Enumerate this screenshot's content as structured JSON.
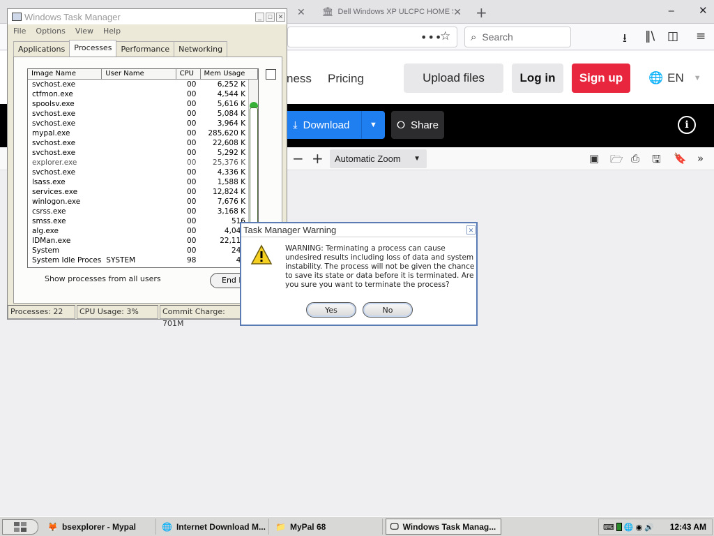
{
  "browser": {
    "tabs": [
      {
        "label": "Dell Windows XP ULCPC HOME S"
      }
    ],
    "toolbar": {
      "search_placeholder": "Search"
    },
    "header": {
      "nav_partial": "ness",
      "pricing": "Pricing",
      "upload": "Upload files",
      "login": "Log in",
      "signup": "Sign up",
      "lang": "EN"
    },
    "actionbar": {
      "download": "Download",
      "share": "Share"
    },
    "pdf": {
      "zoom": "Automatic Zoom"
    }
  },
  "taskmgr": {
    "title": "Windows Task Manager",
    "menu": [
      "File",
      "Options",
      "View",
      "Help"
    ],
    "tabs": [
      "Applications",
      "Processes",
      "Performance",
      "Networking"
    ],
    "columns": {
      "name": "Image Name",
      "user": "User Name",
      "cpu": "CPU",
      "mem": "Mem Usage"
    },
    "processes": [
      {
        "name": "svchost.exe",
        "user": "",
        "cpu": "00",
        "mem": "6,252 K"
      },
      {
        "name": "ctfmon.exe",
        "user": "",
        "cpu": "00",
        "mem": "4,544 K"
      },
      {
        "name": "spoolsv.exe",
        "user": "",
        "cpu": "00",
        "mem": "5,616 K"
      },
      {
        "name": "svchost.exe",
        "user": "",
        "cpu": "00",
        "mem": "5,084 K"
      },
      {
        "name": "svchost.exe",
        "user": "",
        "cpu": "00",
        "mem": "3,964 K"
      },
      {
        "name": "mypal.exe",
        "user": "",
        "cpu": "00",
        "mem": "285,620 K"
      },
      {
        "name": "svchost.exe",
        "user": "",
        "cpu": "00",
        "mem": "22,608 K"
      },
      {
        "name": "svchost.exe",
        "user": "",
        "cpu": "00",
        "mem": "5,292 K"
      },
      {
        "name": "explorer.exe",
        "user": "",
        "cpu": "00",
        "mem": "25,376 K"
      },
      {
        "name": "svchost.exe",
        "user": "",
        "cpu": "00",
        "mem": "4,336 K"
      },
      {
        "name": "lsass.exe",
        "user": "",
        "cpu": "00",
        "mem": "1,588 K"
      },
      {
        "name": "services.exe",
        "user": "",
        "cpu": "00",
        "mem": "12,824 K"
      },
      {
        "name": "winlogon.exe",
        "user": "",
        "cpu": "00",
        "mem": "7,676 K"
      },
      {
        "name": "csrss.exe",
        "user": "",
        "cpu": "00",
        "mem": "3,168 K"
      },
      {
        "name": "smss.exe",
        "user": "",
        "cpu": "00",
        "mem": "516"
      },
      {
        "name": "alg.exe",
        "user": "",
        "cpu": "00",
        "mem": "4,044"
      },
      {
        "name": "IDMan.exe",
        "user": "",
        "cpu": "00",
        "mem": "22,116"
      },
      {
        "name": "System",
        "user": "",
        "cpu": "00",
        "mem": "240"
      },
      {
        "name": "System Idle Process",
        "user": "SYSTEM",
        "cpu": "98",
        "mem": "40"
      }
    ],
    "show_all": "Show processes from all users",
    "end_process": "End Pro",
    "status": {
      "processes": "Processes: 22",
      "cpu": "CPU Usage: 3%",
      "commit": "Commit Charge: 701M"
    }
  },
  "warning": {
    "title": "Task Manager Warning",
    "message": "WARNING: Terminating a process can cause undesired results including loss of data and system instability. The process will not be given the chance to save its state or data before it is terminated.  Are you sure you want to terminate the process?",
    "yes": "Yes",
    "no": "No"
  },
  "taskbar": {
    "items": [
      "bsexplorer - Mypal",
      "Internet Download M...",
      "MyPal 68",
      "Windows Task Manag..."
    ],
    "clock": "12:43 AM"
  }
}
